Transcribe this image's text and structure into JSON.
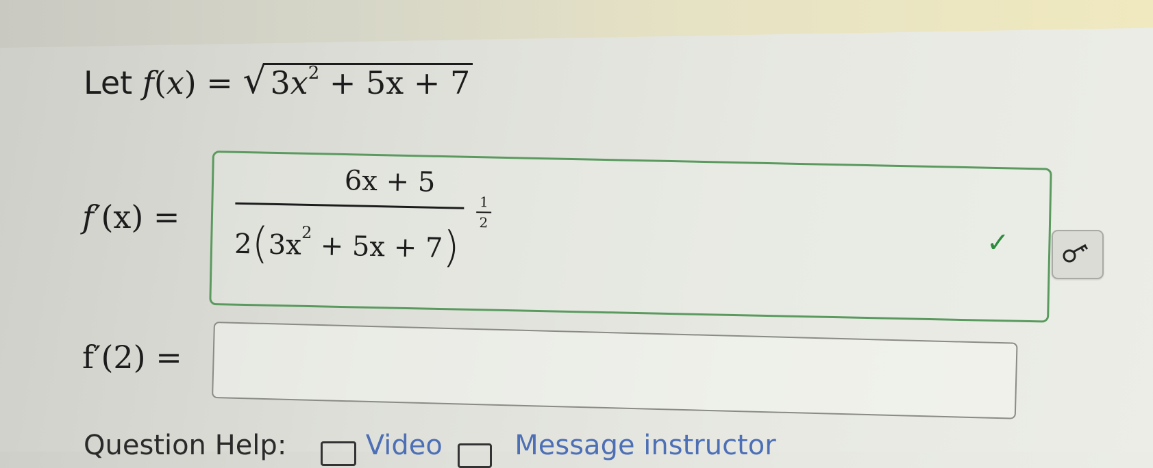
{
  "problem": {
    "let_word": "Let",
    "f_name": "f",
    "variable": "x",
    "radicand_lead": "3",
    "square": "2",
    "radicand_tail": " + 5x + 7"
  },
  "derivative": {
    "label_prefix": "f",
    "label_suffix": "′(x) =",
    "numerator": "6x + 5",
    "denominator_coef": "2",
    "inner_lead": "3x",
    "inner_square": "2",
    "inner_tail": " + 5x + 7",
    "exponent_num": "1",
    "exponent_den": "2",
    "status_icon": "checkmark-icon",
    "status_color": "#2e8b3c",
    "key_button_icon": "key-icon"
  },
  "evaluate": {
    "label": "f′(2) =",
    "value": ""
  },
  "help": {
    "label": "Question Help:",
    "video_link": "Video",
    "message_link": "Message instructor"
  }
}
